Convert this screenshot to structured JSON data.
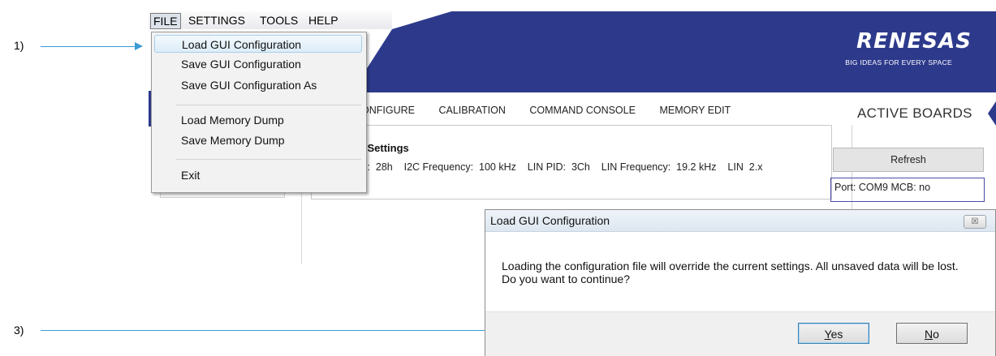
{
  "annotations": {
    "step1": "1)",
    "step3": "3)"
  },
  "app": {
    "menubar": {
      "file": "FILE",
      "settings": "SETTINGS",
      "tools": "TOOLS",
      "help": "HELP"
    },
    "brand": {
      "logo": "RENESAS",
      "tagline": "BIG IDEAS FOR EVERY SPACE",
      "color": "#2d3a8c"
    },
    "tabs": [
      "ONFIGURE",
      "CALIBRATION",
      "COMMAND CONSOLE",
      "MEMORY EDIT"
    ],
    "settings_panel": {
      "title": "on Settings",
      "line": "ess:  28h    I2C Frequency:  100 kHz    LIN PID:  3Ch    LIN Frequency:  19.2 kHz    LIN  2.x"
    },
    "active_boards": {
      "heading": "ACTIVE BOARDS",
      "refresh": "Refresh",
      "port": "Port: COM9   MCB: no"
    },
    "file_menu": {
      "items": [
        {
          "label": "Load GUI Configuration",
          "highlighted": true
        },
        {
          "label": "Save GUI Configuration"
        },
        {
          "label": "Save GUI Configuration As"
        },
        {
          "label": "Load Memory Dump"
        },
        {
          "label": "Save Memory Dump"
        },
        {
          "label": "Exit"
        }
      ]
    }
  },
  "dialog": {
    "title": "Load GUI Configuration",
    "close_glyph": "☒",
    "message": "Loading the configuration file will override the current settings. All unsaved data will be lost. Do you want to continue?",
    "yes_accel": "Y",
    "yes_rest": "es",
    "no_accel": "N",
    "no_rest": "o"
  }
}
